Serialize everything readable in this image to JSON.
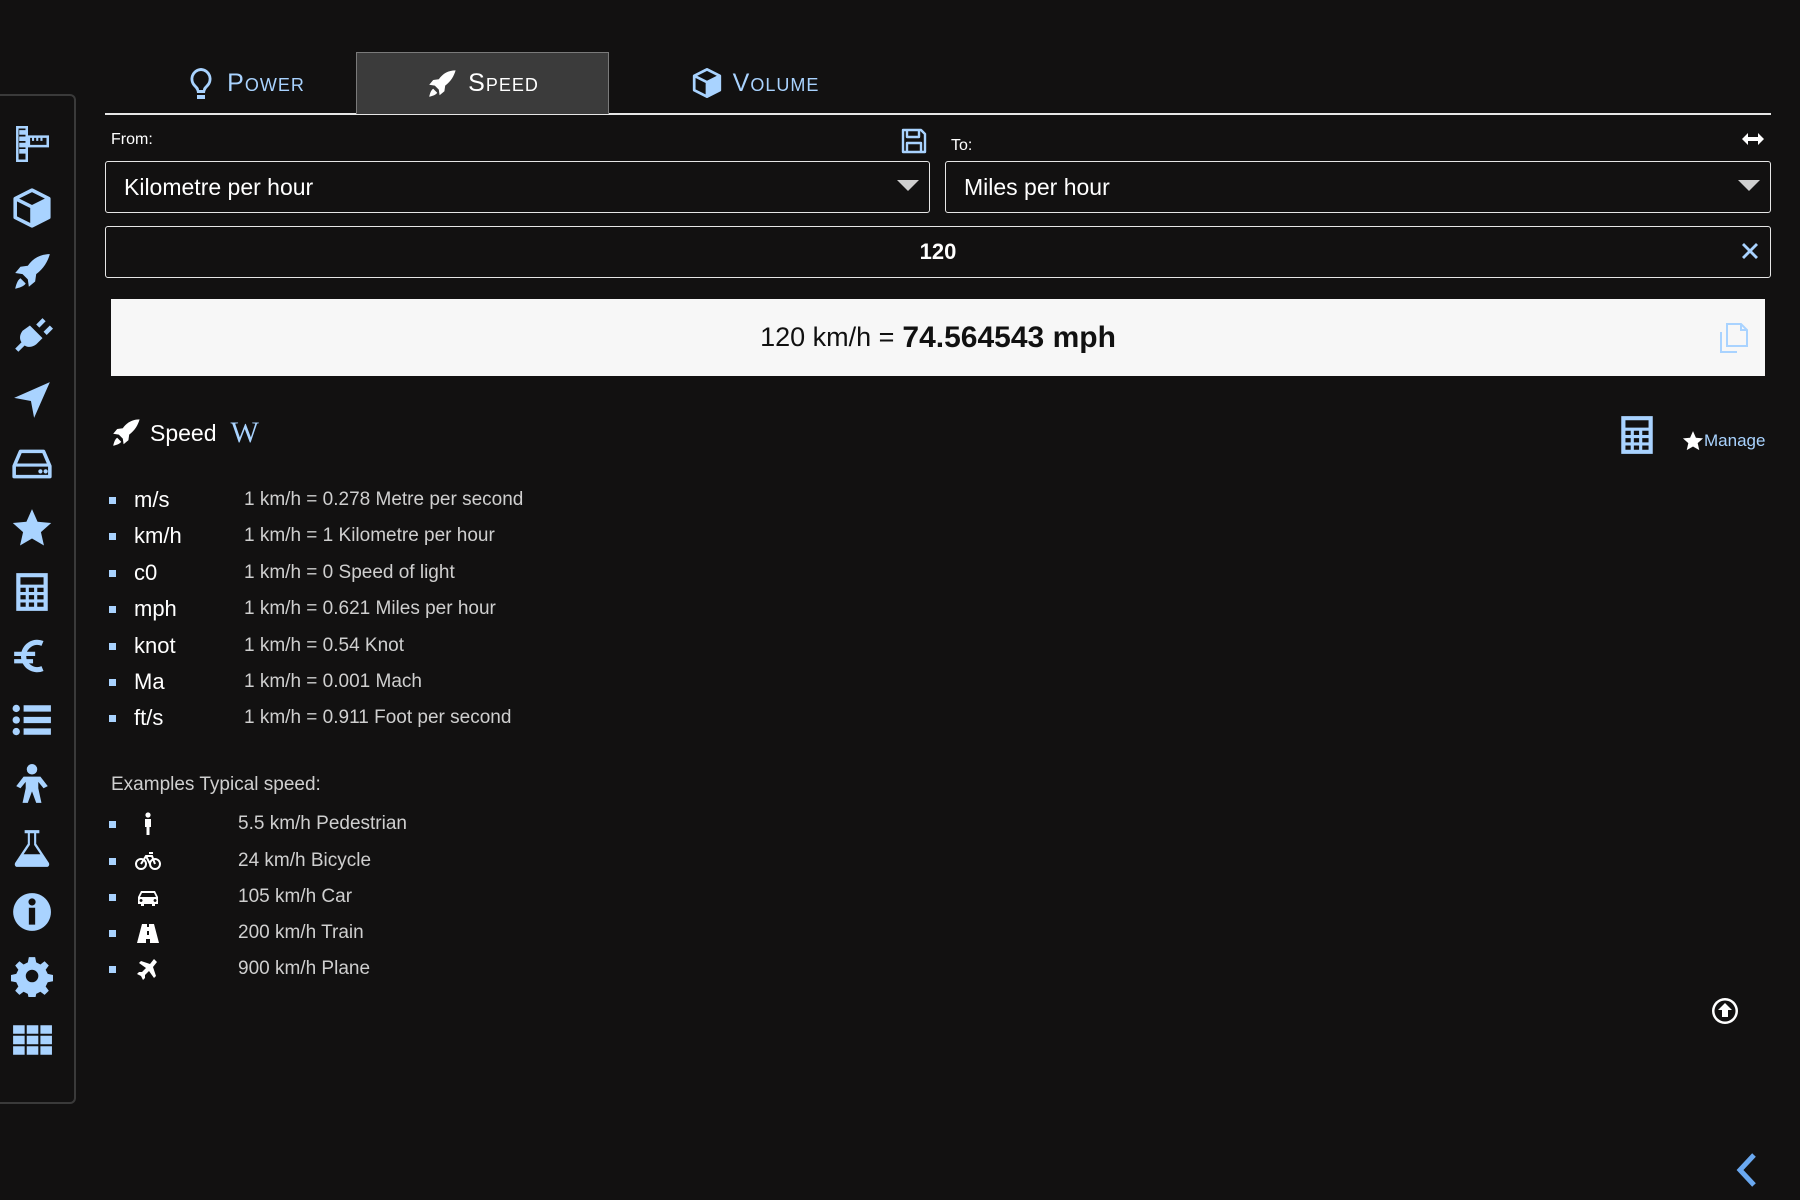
{
  "tabs": [
    {
      "label": "Power",
      "icon": "bulb-icon"
    },
    {
      "label": "Speed",
      "icon": "rocket-icon"
    },
    {
      "label": "Volume",
      "icon": "cube-icon"
    }
  ],
  "from": {
    "label": "From:",
    "unit": "Kilometre per hour"
  },
  "to": {
    "label": "To:",
    "unit": "Miles per hour"
  },
  "input_value": "120",
  "result": {
    "expression": "120 km/h =",
    "value": "74.564543 mph"
  },
  "category": {
    "title": "Speed",
    "wiki": "W",
    "manage": "Manage"
  },
  "units": [
    {
      "symbol": "m/s",
      "desc": "1 km/h = 0.278 Metre per second"
    },
    {
      "symbol": "km/h",
      "desc": "1 km/h = 1 Kilometre per hour"
    },
    {
      "symbol": "c0",
      "desc": "1 km/h = 0 Speed of light"
    },
    {
      "symbol": "mph",
      "desc": "1 km/h = 0.621 Miles per hour"
    },
    {
      "symbol": "knot",
      "desc": "1 km/h = 0.54 Knot"
    },
    {
      "symbol": "Ma",
      "desc": "1 km/h = 0.001 Mach"
    },
    {
      "symbol": "ft/s",
      "desc": "1 km/h = 0.911 Foot per second"
    }
  ],
  "examples": {
    "title": "Examples Typical speed:",
    "items": [
      {
        "icon": "pedestrian-icon",
        "text": "5.5 km/h Pedestrian"
      },
      {
        "icon": "bicycle-icon",
        "text": "24 km/h Bicycle"
      },
      {
        "icon": "car-icon",
        "text": "105 km/h Car"
      },
      {
        "icon": "road-icon",
        "text": "200 km/h Train"
      },
      {
        "icon": "plane-icon",
        "text": "900 km/h Plane"
      }
    ]
  },
  "sidebar_icons": [
    "ruler-icon",
    "cube-icon",
    "rocket-icon",
    "plug-icon",
    "location-arrow-icon",
    "hard-drive-icon",
    "star-icon",
    "calculator-icon",
    "euro-icon",
    "list-icon",
    "child-icon",
    "flask-icon",
    "info-icon",
    "gear-icon",
    "grid-icon"
  ],
  "colors": {
    "accent": "#a9d3ff",
    "background": "#121111",
    "active_tab": "#3b3b3b",
    "result_bg": "#f7f7f7"
  }
}
